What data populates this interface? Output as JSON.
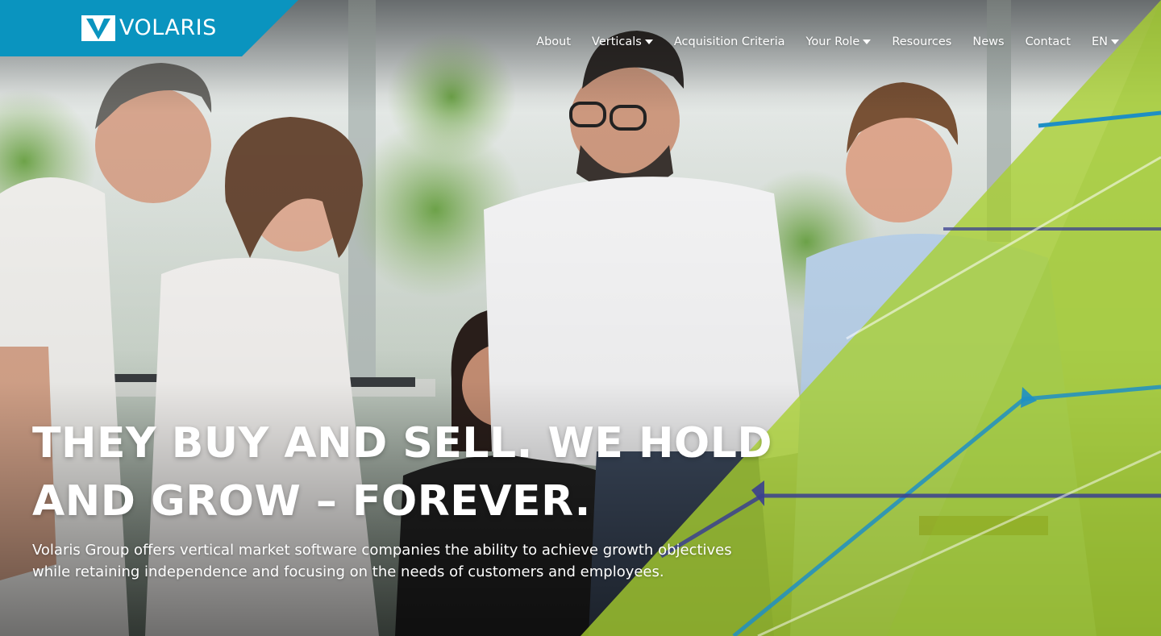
{
  "brand": {
    "name": "VOLARIS",
    "logo_icon": "volaris-v-mark",
    "tab_color": "#0a94bf"
  },
  "nav": {
    "items": [
      {
        "label": "About",
        "has_dropdown": false
      },
      {
        "label": "Verticals",
        "has_dropdown": true
      },
      {
        "label": "Acquisition Criteria",
        "has_dropdown": false
      },
      {
        "label": "Your Role",
        "has_dropdown": true
      },
      {
        "label": "Resources",
        "has_dropdown": false
      },
      {
        "label": "News",
        "has_dropdown": false
      },
      {
        "label": "Contact",
        "has_dropdown": false
      },
      {
        "label": "EN",
        "has_dropdown": true
      }
    ],
    "caret_icon": "caret-down-icon"
  },
  "hero": {
    "headline_line1": "THEY BUY AND SELL. WE HOLD",
    "headline_line2": "AND GROW – FOREVER.",
    "subtext_line1": "Volaris Group offers vertical market software companies the ability to achieve growth objectives",
    "subtext_line2": "while retaining independence and focusing on the needs of customers and employees.",
    "photo": "group-of-five-coworkers-smiling-photo",
    "accent_green": "#a8cf2e",
    "accent_blue": "#1e8fc4",
    "accent_navy": "#3a3f8f"
  }
}
